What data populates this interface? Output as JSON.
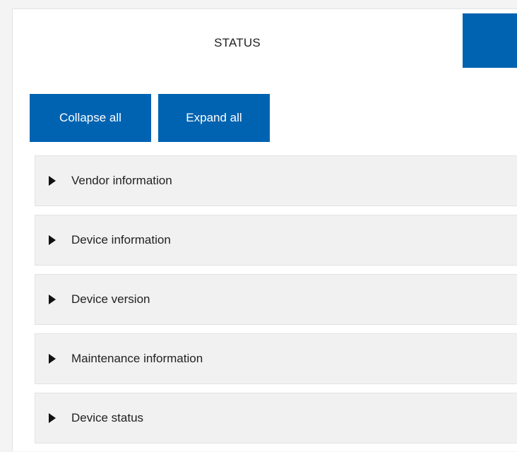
{
  "tabs": {
    "status_label": "STATUS"
  },
  "toolbar": {
    "collapse_label": "Collapse all",
    "expand_label": "Expand all"
  },
  "sections": [
    {
      "label": "Vendor information",
      "expanded": false
    },
    {
      "label": "Device information",
      "expanded": false
    },
    {
      "label": "Device version",
      "expanded": false
    },
    {
      "label": "Maintenance information",
      "expanded": false
    },
    {
      "label": "Device status",
      "expanded": false
    }
  ],
  "colors": {
    "accent": "#0063b1",
    "section_bg": "#f1f1f1"
  },
  "icons": {
    "section_toggle": "caret-right-icon"
  }
}
